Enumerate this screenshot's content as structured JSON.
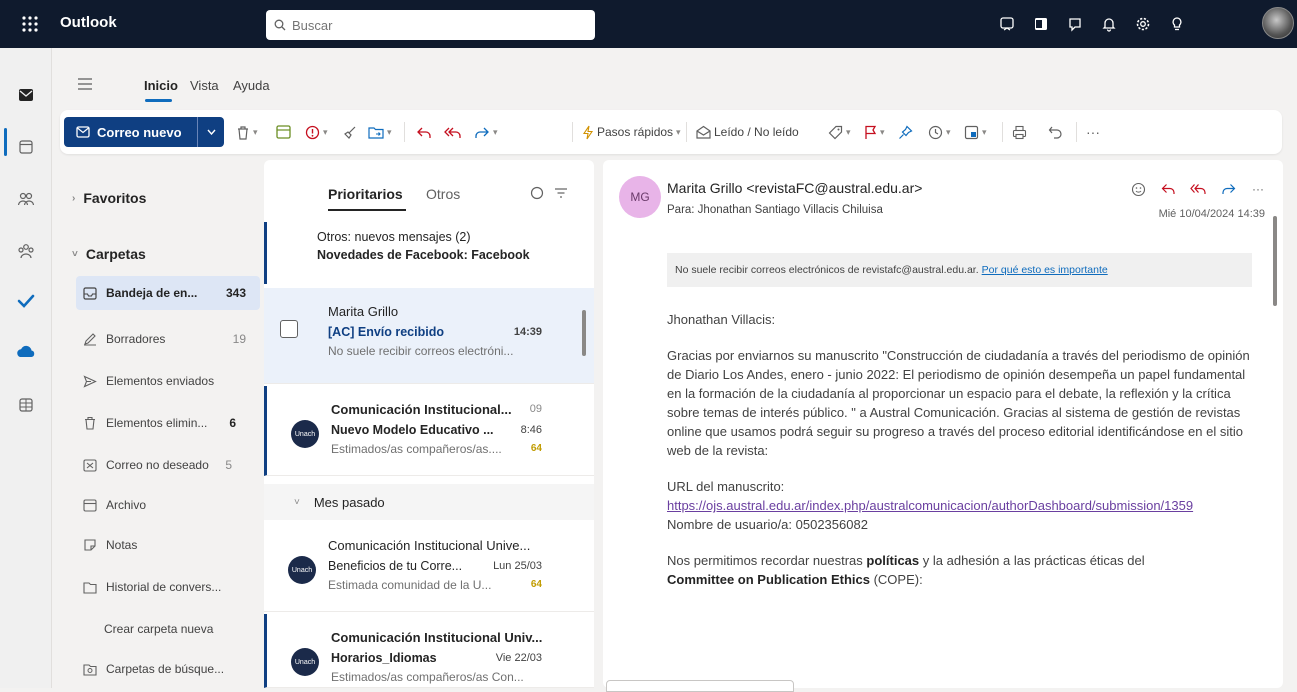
{
  "app": {
    "name": "Outlook"
  },
  "search": {
    "placeholder": "Buscar"
  },
  "ribbon": {
    "tabs": [
      {
        "label": "Inicio"
      },
      {
        "label": "Vista"
      },
      {
        "label": "Ayuda"
      }
    ]
  },
  "toolbar": {
    "new_mail": "Correo nuevo",
    "quick_steps": "Pasos rápidos",
    "read_unread": "Leído / No leído"
  },
  "folders": {
    "favorites": "Favoritos",
    "folders_header": "Carpetas",
    "items": [
      {
        "label": "Bandeja de en...",
        "count": "343",
        "icon": "inbox-icon"
      },
      {
        "label": "Borradores",
        "count": "19",
        "icon": "drafts-icon"
      },
      {
        "label": "Elementos enviados",
        "count": "",
        "icon": "sent-icon"
      },
      {
        "label": "Elementos elimin...",
        "count": "6",
        "icon": "trash-icon"
      },
      {
        "label": "Correo no deseado",
        "count": "5",
        "icon": "junk-icon"
      },
      {
        "label": "Archivo",
        "count": "",
        "icon": "archive-icon"
      },
      {
        "label": "Notas",
        "count": "",
        "icon": "notes-icon"
      },
      {
        "label": "Historial de convers...",
        "count": "",
        "icon": "history-icon"
      },
      {
        "label": "Crear carpeta nueva",
        "count": "",
        "icon": ""
      },
      {
        "label": "Carpetas de búsque...",
        "count": "",
        "icon": "search-folder-icon"
      }
    ]
  },
  "list": {
    "tabs": [
      {
        "label": "Prioritarios"
      },
      {
        "label": "Otros"
      }
    ],
    "others_banner": {
      "line1": "Otros: nuevos mensajes (2)",
      "line2": "Novedades de Facebook: Facebook"
    },
    "group_label": "Mes pasado",
    "messages": [
      {
        "sender": "Marita Grillo",
        "subject": "[AC] Envío recibido",
        "preview": "No suele recibir correos electróni...",
        "time": "14:39",
        "extra_time": "",
        "tag": ""
      },
      {
        "sender": "Comunicación Institucional...",
        "subject": "Nuevo Modelo Educativo ...",
        "preview": "Estimados/as compañeros/as....",
        "time": "8:46",
        "extra_time": "09",
        "tag": "64",
        "avatar": "Unach"
      },
      {
        "sender": "Comunicación Institucional Unive...",
        "subject": "Beneficios de tu Corre...",
        "preview": "Estimada comunidad de la U...",
        "time": "Lun 25/03",
        "extra_time": "",
        "tag": "64",
        "avatar": "Unach"
      },
      {
        "sender": "Comunicación Institucional Univ...",
        "subject": "Horarios_Idiomas",
        "preview": "Estimados/as compañeros/as Con...",
        "time": "Vie 22/03",
        "extra_time": "",
        "tag": "",
        "avatar": "Unach"
      }
    ]
  },
  "reading": {
    "avatar_initials": "MG",
    "sender": "Marita Grillo <revistaFC@austral.edu.ar>",
    "to": "Para: Jhonathan Santiago Villacis Chiluisa",
    "date": "Mié 10/04/2024 14:39",
    "warning": "No suele recibir correos electrónicos de revistafc@austral.edu.ar.",
    "warning_link": "Por qué esto es importante",
    "greeting": "Jhonathan Villacis:",
    "p1": "Gracias por enviarnos su manuscrito \"Construcción de ciudadanía a través del periodismo de opinión de Diario Los Andes, enero - junio 2022: El periodismo de opinión desempeña un papel fundamental en la formación de la ciudadanía al proporcionar un espacio para el debate, la reflexión y la crítica sobre temas de interés público. \" a Austral Comunicación. Gracias al sistema de gestión de revistas online que usamos podrá seguir su progreso a través del proceso editorial identificándose en el sitio web de la revista:",
    "url_label": "URL del manuscrito:",
    "url": "https://ojs.austral.edu.ar/index.php/australcomunicacion/authorDashboard/submission/1359",
    "username": "Nombre de usuario/a: 0502356082",
    "p3_a": "Nos permitimos recordar nuestras ",
    "p3_b": "políticas",
    "p3_c": " y la adhesión a las prácticas éticas del ",
    "p3_d": "Committee on Publication Ethics",
    "p3_e": " (COPE):"
  }
}
